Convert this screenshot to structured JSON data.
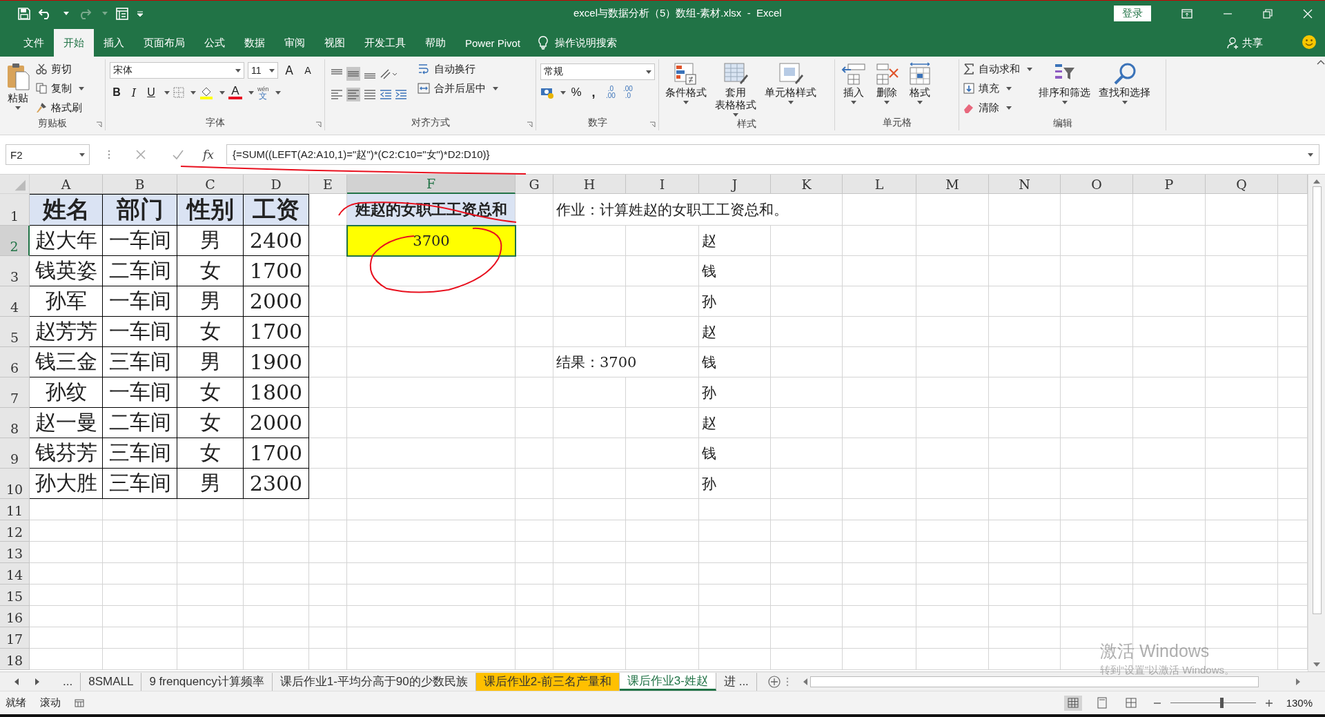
{
  "title_bar": {
    "title": "excel与数据分析（5）数组-素材.xlsx  -  Excel",
    "sign_in": "登录"
  },
  "ribbon_tabs": [
    {
      "label": "文件",
      "selected": false
    },
    {
      "label": "开始",
      "selected": true
    },
    {
      "label": "插入",
      "selected": false
    },
    {
      "label": "页面布局",
      "selected": false
    },
    {
      "label": "公式",
      "selected": false
    },
    {
      "label": "数据",
      "selected": false
    },
    {
      "label": "审阅",
      "selected": false
    },
    {
      "label": "视图",
      "selected": false
    },
    {
      "label": "开发工具",
      "selected": false
    },
    {
      "label": "帮助",
      "selected": false
    },
    {
      "label": "Power Pivot",
      "selected": false
    }
  ],
  "tell_me": "操作说明搜索",
  "share": "共享",
  "ribbon": {
    "clipboard": {
      "label": "剪贴板",
      "paste": "粘贴",
      "cut": "剪切",
      "copy": "复制",
      "format_painter": "格式刷"
    },
    "font": {
      "label": "字体",
      "font_name": "宋体",
      "font_size": "11",
      "grow": "A",
      "shrink": "A",
      "bold": "B",
      "italic": "I",
      "underline": "U",
      "font_color": "A",
      "phonetic_top": "wén",
      "phonetic": "文"
    },
    "alignment": {
      "label": "对齐方式",
      "wrap_text": "自动换行",
      "merge_center": "合并后居中"
    },
    "number": {
      "label": "数字",
      "format": "常规",
      "percent": "%",
      "comma": ",",
      "increase_decimal": [
        ".0",
        ".00"
      ],
      "decrease_decimal": [
        ".00",
        ".0"
      ]
    },
    "styles": {
      "label": "样式",
      "buttons": [
        {
          "kind": "conditional",
          "lines": [
            "条件格式"
          ]
        },
        {
          "kind": "table",
          "lines": [
            "套用",
            "表格格式"
          ]
        },
        {
          "kind": "cellstyle",
          "lines": [
            "单元格样式"
          ]
        }
      ]
    },
    "cells": {
      "label": "单元格",
      "buttons": [
        {
          "kind": "insert",
          "label": "插入"
        },
        {
          "kind": "delete",
          "label": "删除"
        },
        {
          "kind": "format",
          "label": "格式"
        }
      ]
    },
    "editing": {
      "label": "编辑",
      "small": [
        {
          "kind": "autosum",
          "label": "自动求和"
        },
        {
          "kind": "fill",
          "label": "填充"
        },
        {
          "kind": "clear",
          "label": "清除"
        }
      ],
      "large": [
        {
          "kind": "sort",
          "label": "排序和筛选"
        },
        {
          "kind": "find",
          "label": "查找和选择"
        }
      ]
    }
  },
  "formula_bar": {
    "name_box": "F2",
    "function_label": "fx",
    "formula": "{=SUM((LEFT(A2:A10,1)=\"赵\")*(C2:C10=\"女\")*D2:D10)}"
  },
  "sheet": {
    "columns": [
      {
        "label": "A",
        "selected": false
      },
      {
        "label": "B",
        "selected": false
      },
      {
        "label": "C",
        "selected": false
      },
      {
        "label": "D",
        "selected": false
      },
      {
        "label": "E",
        "selected": false
      },
      {
        "label": "F",
        "selected": true
      },
      {
        "label": "G",
        "selected": false
      },
      {
        "label": "H",
        "selected": false
      },
      {
        "label": "I",
        "selected": false
      },
      {
        "label": "J",
        "selected": false
      },
      {
        "label": "K",
        "selected": false
      },
      {
        "label": "L",
        "selected": false
      },
      {
        "label": "M",
        "selected": false
      },
      {
        "label": "N",
        "selected": false
      },
      {
        "label": "O",
        "selected": false
      },
      {
        "label": "P",
        "selected": false
      },
      {
        "label": "Q",
        "selected": false
      }
    ],
    "rows": [
      {
        "label": "1",
        "selected": false
      },
      {
        "label": "2",
        "selected": true
      },
      {
        "label": "3",
        "selected": false
      },
      {
        "label": "4",
        "selected": false
      },
      {
        "label": "5",
        "selected": false
      },
      {
        "label": "6",
        "selected": false
      },
      {
        "label": "7",
        "selected": false
      },
      {
        "label": "8",
        "selected": false
      },
      {
        "label": "9",
        "selected": false
      },
      {
        "label": "10",
        "selected": false
      },
      {
        "label": "11",
        "selected": false
      },
      {
        "label": "12",
        "selected": false
      },
      {
        "label": "13",
        "selected": false
      },
      {
        "label": "14",
        "selected": false
      },
      {
        "label": "15",
        "selected": false
      },
      {
        "label": "16",
        "selected": false
      },
      {
        "label": "17",
        "selected": false
      },
      {
        "label": "18",
        "selected": false
      }
    ],
    "data_table": {
      "header": [
        "姓名",
        "部门",
        "性别",
        "工资"
      ],
      "rows": [
        [
          "赵大年",
          "一车间",
          "男",
          "2400"
        ],
        [
          "钱英姿",
          "二车间",
          "女",
          "1700"
        ],
        [
          "孙军",
          "一车间",
          "男",
          "2000"
        ],
        [
          "赵芳芳",
          "一车间",
          "女",
          "1700"
        ],
        [
          "钱三金",
          "三车间",
          "男",
          "1900"
        ],
        [
          "孙纹",
          "一车间",
          "女",
          "1800"
        ],
        [
          "赵一曼",
          "二车间",
          "女",
          "2000"
        ],
        [
          "钱芬芳",
          "三车间",
          "女",
          "1700"
        ],
        [
          "孙大胜",
          "三车间",
          "男",
          "2300"
        ]
      ]
    },
    "result": {
      "heading": "姓赵的女职工工资总和",
      "value": "3700",
      "selected": true
    },
    "notes": [
      "作业：计算姓赵的女职工工资总和。",
      "结果：3700"
    ],
    "surname_column": [
      "赵",
      "钱",
      "孙",
      "赵",
      "钱",
      "孙",
      "赵",
      "钱",
      "孙"
    ]
  },
  "sheet_tabs": {
    "overflow": "...",
    "tabs": [
      {
        "label": "8SMALL",
        "selected": false
      },
      {
        "label": "9 frenquency计算频率",
        "selected": false
      },
      {
        "label": "课后作业1-平均分高于90的少数民族",
        "selected": false
      },
      {
        "label": "课后作业2-前三名产量和",
        "selected": false,
        "color": "#ffc000"
      },
      {
        "label": "课后作业3-姓赵",
        "selected": true
      },
      {
        "label": "进 ...",
        "selected": false
      }
    ]
  },
  "status_bar": {
    "items": [
      "就绪",
      "滚动"
    ],
    "zoom": "130%",
    "zoom_slider": {
      "level": 0.6
    }
  },
  "os_watermark": [
    "激活 Windows",
    "转到“设置”以激活 Windows。"
  ]
}
